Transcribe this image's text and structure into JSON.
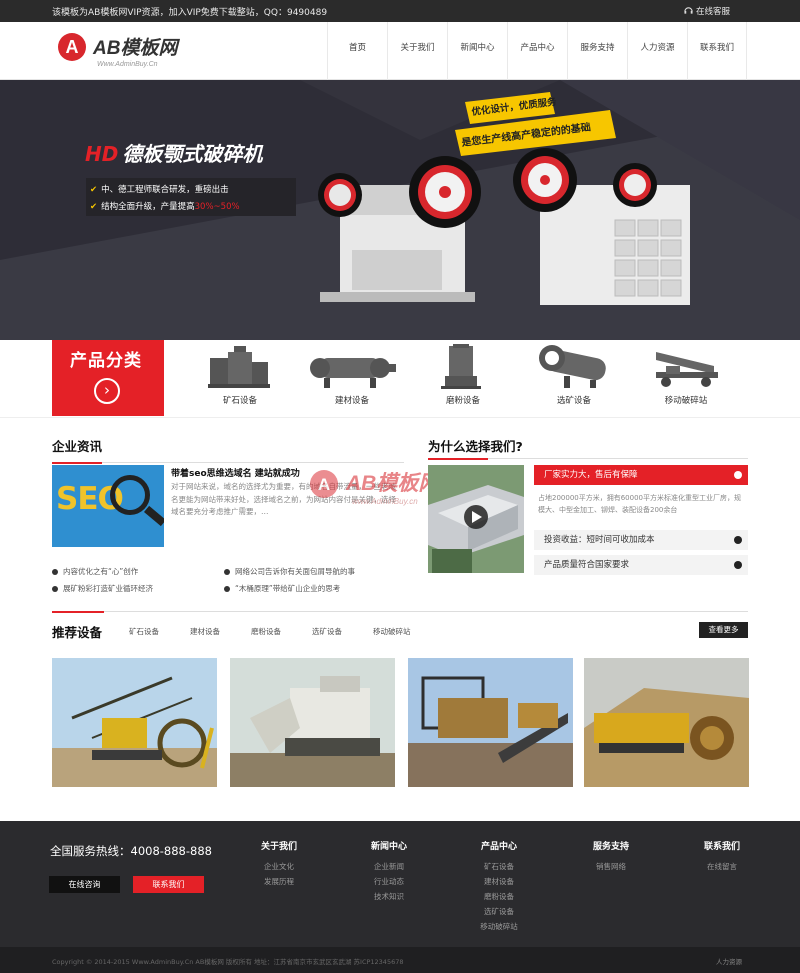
{
  "topbar": {
    "note": "该模板为AB模板网VIP资源，加入VIP免费下载整站，QQ：9490489",
    "service": "在线客服"
  },
  "logo": {
    "mark": "A",
    "name": "AB模板网",
    "url": "Www.AdminBuy.Cn"
  },
  "nav": [
    "首页",
    "关于我们",
    "新闻中心",
    "产品中心",
    "服务支持",
    "人力资源",
    "联系我们"
  ],
  "banner": {
    "title_hd": "HD",
    "title": "德板颚式破碎机",
    "bullet1": "中、德工程师联合研发，重磅出击",
    "bullet2_a": "结构全面升级，产量提高",
    "bullet2_b": "30%~50%",
    "tag1": "优化设计，优质服务",
    "tag2": "是您生产线高产稳定的的基础"
  },
  "categories": {
    "title": "产品分类",
    "items": [
      "矿石设备",
      "建材设备",
      "磨粉设备",
      "选矿设备",
      "移动破碎站"
    ]
  },
  "news": {
    "title": "企业资讯",
    "seo_text": "SEO",
    "headline": "带着seo思维选域名 建站就成功",
    "desc": "对于网站来说，域名的选择尤为重要，有的域名自带流量，一些老域名更能为网站带来好处，选择域名之前，为网站内容付是关键，选择域名要充分考虑推广需要，…",
    "list": [
      "内容优化之有“心”创作",
      "网络公司告诉你有关面包屑导航的事",
      "展矿粉彩打造矿业循环经济",
      "“木桶原理”带给矿山企业的思考"
    ]
  },
  "watermark": {
    "name": "AB模板网",
    "url": "www.AdminBuy.cn"
  },
  "why": {
    "title": "为什么选择我们?",
    "acc1": "厂家实力大，售后有保障",
    "acc1_desc": "占地200000平方米，拥有60000平方米标准化重型工业厂房，规模大、中型金加工、铆焊、装配设备200余台",
    "acc2": "投资收益：短时间可收加成本",
    "acc3": "产品质量符合国家要求"
  },
  "recommend": {
    "title": "推荐设备",
    "tabs": [
      "矿石设备",
      "建材设备",
      "磨粉设备",
      "选矿设备",
      "移动破碎站"
    ],
    "more": "查看更多"
  },
  "footer": {
    "hotline": "全国服务热线：4008-888-888",
    "btn_consult": "在线咨询",
    "btn_contact": "联系我们",
    "cols": [
      {
        "h": "关于我们",
        "items": [
          "企业文化",
          "发展历程"
        ]
      },
      {
        "h": "新闻中心",
        "items": [
          "企业新闻",
          "行业动态",
          "技术知识"
        ]
      },
      {
        "h": "产品中心",
        "items": [
          "矿石设备",
          "建材设备",
          "磨粉设备",
          "选矿设备",
          "移动破碎站"
        ]
      },
      {
        "h": "服务支持",
        "items": [
          "销售网络"
        ]
      },
      {
        "h": "联系我们",
        "items": [
          "在线留言"
        ]
      }
    ],
    "copyright": "Copyright © 2014-2015 Www.AdminBuy.Cn AB模板网 版权所有    地址：江苏省南京市玄武区玄武湖    苏ICP12345678",
    "talent": "人力资源"
  },
  "colors": {
    "accent": "#e42127",
    "dark": "#2b2b2e",
    "banner_bg": "#2e2d37",
    "tag_yellow": "#f7c600"
  }
}
